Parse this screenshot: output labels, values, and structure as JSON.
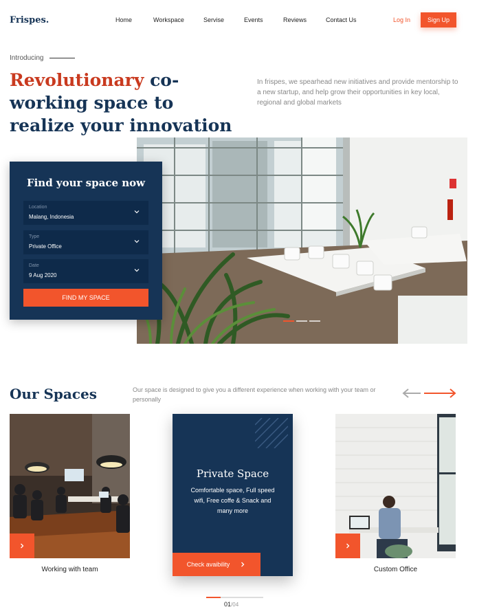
{
  "header": {
    "logo": "Frispes.",
    "nav": [
      "Home",
      "Workspace",
      "Servise",
      "Events",
      "Reviews",
      "Contact Us"
    ],
    "login": "Log In",
    "signup": "Sign Up"
  },
  "hero": {
    "intro": "Introducing",
    "headline_accent": "Revolutionary",
    "headline_rest": " co-working space to realize your innovation",
    "description": "In frispes, we spearhead new initiatives and provide mentorship to a new startup, and help grow their opportunities in key local, regional and global markets",
    "slider_active_index": 0,
    "slider_count": 3
  },
  "booking": {
    "title": "Find your space now",
    "fields": [
      {
        "label": "Location",
        "value": "Malang, Indonesia"
      },
      {
        "label": "Type",
        "value": "Private Office"
      },
      {
        "label": "Date",
        "value": "9 Aug 2020"
      }
    ],
    "button": "FIND MY SPACE"
  },
  "spaces": {
    "title": "Our Spaces",
    "description": "Our space is designed to give you a different experience when working with your team or personally",
    "cards": [
      {
        "caption": "Working with team"
      },
      {
        "title": "Private Space",
        "description": "Comfortable space, Full speed wifi, Free coffe & Snack and many more",
        "button": "Check avaibility"
      },
      {
        "caption": "Custom Office"
      }
    ],
    "pager_current": "01",
    "pager_total": "/04"
  },
  "colors": {
    "navy": "#163456",
    "accent": "#f2552c",
    "headline_accent": "#c93a1f"
  },
  "icons": [
    "chevron-down-icon",
    "chevron-right-icon",
    "arrow-left-icon",
    "arrow-right-icon"
  ]
}
